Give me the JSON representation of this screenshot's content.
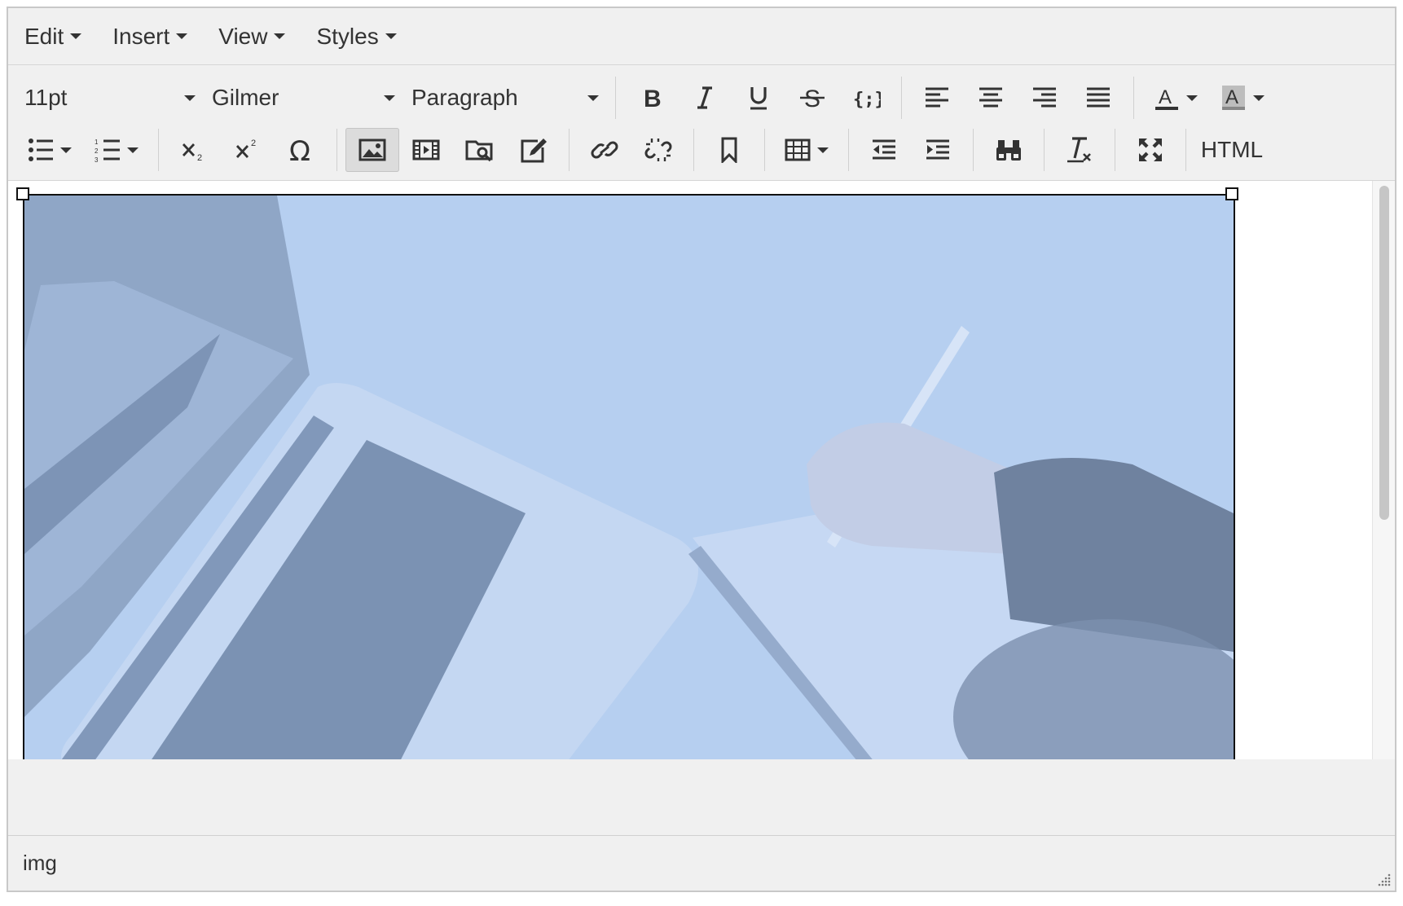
{
  "menubar": {
    "items": [
      {
        "label": "Edit"
      },
      {
        "label": "Insert"
      },
      {
        "label": "View"
      },
      {
        "label": "Styles"
      }
    ]
  },
  "toolbar": {
    "font_size": "11pt",
    "font_family": "Gilmer",
    "block_format": "Paragraph",
    "html_label": "HTML",
    "text_color_glyph": "A",
    "bg_color_glyph": "A",
    "text_color_accent": "#333333",
    "bg_color_accent": "#888888",
    "icons": {
      "bold": "bold-icon",
      "italic": "italic-icon",
      "underline": "underline-icon",
      "strikethrough": "strikethrough-icon",
      "code": "code-braces-icon",
      "insert_image": "image-icon"
    }
  },
  "content": {
    "tint_color": "#b6cff0"
  },
  "statusbar": {
    "path": "img"
  }
}
